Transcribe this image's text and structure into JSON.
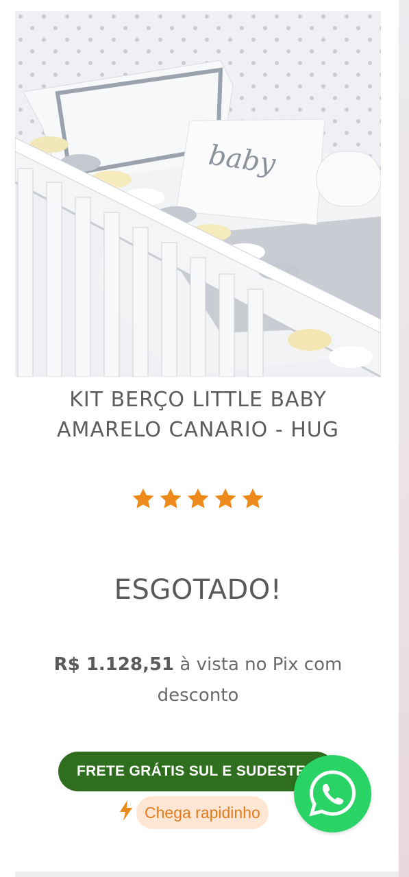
{
  "product": {
    "title_line1": "KIT BERÇO LITTLE BABY",
    "title_line2": "AMARELO CANARIO - HUG",
    "image_text": "baby",
    "rating": 5,
    "status": "ESGOTADO!",
    "pix": {
      "price": "R$ 1.128,51",
      "text": " à vista no Pix com desconto"
    },
    "shipping_badge": "FRETE GRÁTIS SUL E SUDESTE",
    "fast_delivery": "Chega rapidinho"
  },
  "colors": {
    "star": "#ee8a1b",
    "shipping_badge_bg": "#2f6e1f",
    "fast_pill_bg": "#fde7d4",
    "fast_text": "#e27a1b",
    "whatsapp": "#29d366"
  },
  "icons": {
    "rating": "star-icon",
    "fast": "lightning-bolt-icon",
    "chat": "whatsapp-icon"
  }
}
